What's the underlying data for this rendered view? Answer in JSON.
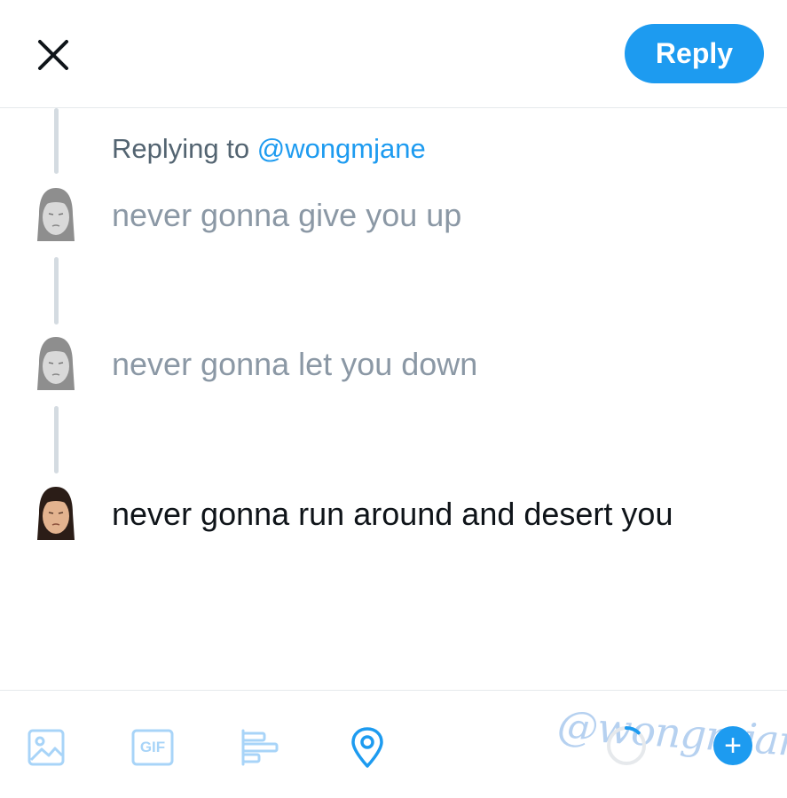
{
  "header": {
    "reply_label": "Reply"
  },
  "thread": {
    "replying_to_prefix": "Replying to ",
    "replying_to_handle": "@wongmjane",
    "tweets": [
      {
        "text": "never gonna give you up",
        "state": "faded"
      },
      {
        "text": "never gonna let you down",
        "state": "faded"
      },
      {
        "text": "never gonna run around and desert you",
        "state": "active"
      }
    ]
  },
  "toolbar": {
    "gif_label": "GIF",
    "watermark": "@wongmjane",
    "character_progress": 0.12,
    "add_label": "+",
    "icons": [
      "image-icon",
      "gif-icon",
      "poll-icon",
      "location-icon"
    ]
  },
  "colors": {
    "accent": "#1d9bf0",
    "faded_text": "#8b98a5",
    "text": "#0f1419",
    "muted": "#536471",
    "divider": "#e6e9ec"
  }
}
